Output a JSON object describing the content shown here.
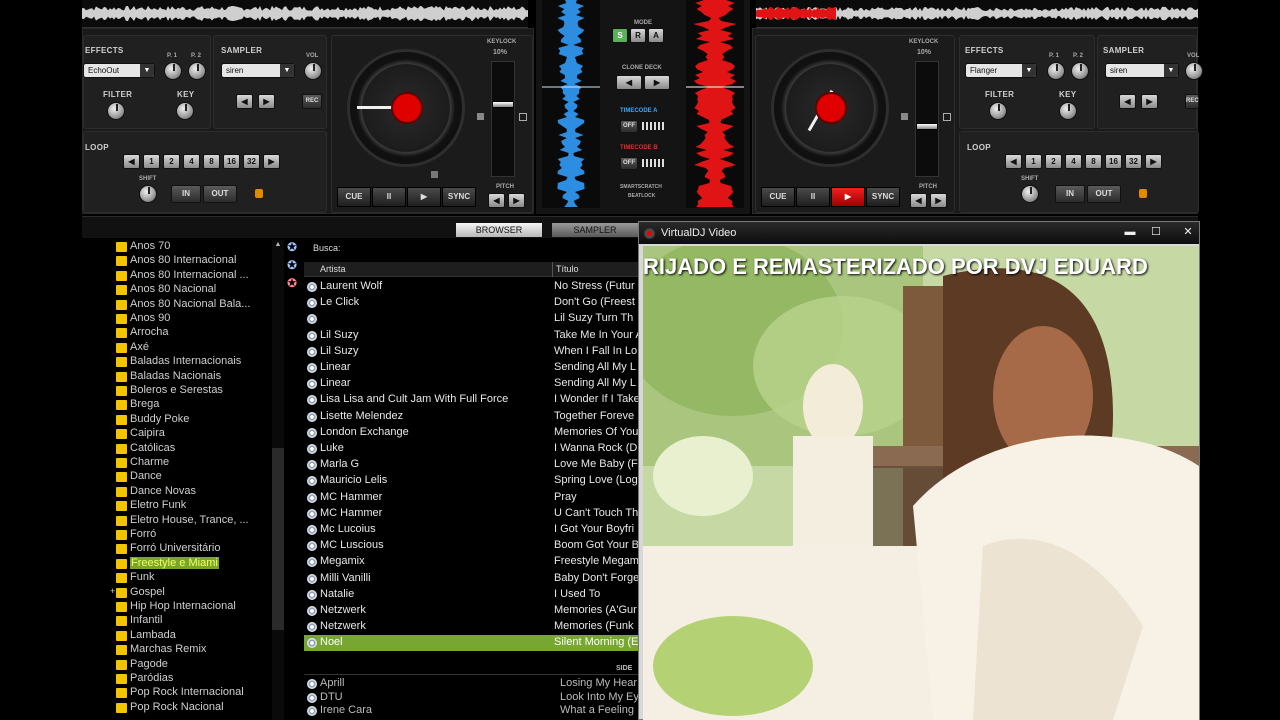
{
  "deck_left": {
    "effects": {
      "label": "EFFECTS",
      "value": "EchoOut",
      "p1": "P. 1",
      "p2": "P. 2"
    },
    "sampler": {
      "label": "SAMPLER",
      "value": "siren",
      "vol": "VOL",
      "rec": "REC"
    },
    "filter": "FILTER",
    "key": "KEY",
    "loop": {
      "label": "LOOP",
      "sizes": [
        "1",
        "2",
        "4",
        "8",
        "16",
        "32"
      ],
      "shift": "SHIFT",
      "in": "IN",
      "out": "OUT"
    },
    "keylock": "KEYLOCK",
    "pitch_pct": "10%",
    "pitch": "PITCH",
    "transport": {
      "cue": "CUE",
      "pause": "II",
      "play": "▶",
      "sync": "SYNC"
    }
  },
  "deck_right": {
    "effects": {
      "label": "EFFECTS",
      "value": "Flanger",
      "p1": "P. 1",
      "p2": "P. 2"
    },
    "sampler": {
      "label": "SAMPLER",
      "value": "siren",
      "vol": "VOL",
      "rec": "REC"
    },
    "filter": "FILTER",
    "key": "KEY",
    "loop": {
      "label": "LOOP",
      "sizes": [
        "1",
        "2",
        "4",
        "8",
        "16",
        "32"
      ],
      "shift": "SHIFT",
      "in": "IN",
      "out": "OUT"
    },
    "keylock": "KEYLOCK",
    "pitch_pct": "10%",
    "pitch": "PITCH",
    "transport": {
      "cue": "CUE",
      "pause": "II",
      "play": "▶",
      "sync": "SYNC"
    }
  },
  "mixer": {
    "mode": "MODE",
    "mode_buttons": [
      "S",
      "R",
      "A"
    ],
    "clone_deck": "CLONE DECK",
    "timecode_a": "TIMECODE A",
    "timecode_b": "TIMECODE B",
    "off": "OFF",
    "smartscratch": "SMARTSCRATCH",
    "beatlock": "BEATLOCK"
  },
  "tabs": {
    "browser": "BROWSER",
    "sampler": "SAMPLER"
  },
  "search_label": "Busca:",
  "columns": {
    "artist": "Artista",
    "title": "Título"
  },
  "folders": [
    "Anos 70",
    "Anos 80 Internacional",
    "Anos 80 Internacional ...",
    "Anos 80 Nacional",
    "Anos 80 Nacional Bala...",
    "Anos 90",
    "Arrocha",
    "Axé",
    "Baladas Internacionais",
    "Baladas Nacionais",
    "Boleros e Serestas",
    "Brega",
    "Buddy Poke",
    "Caipira",
    "Católicas",
    "Charme",
    "Dance",
    "Dance Novas",
    "Eletro Funk",
    "Eletro House, Trance, ...",
    "Forró",
    "Forró Universitário",
    "Freestyle e Miami",
    "Funk",
    "Gospel",
    "Hip Hop Internacional",
    "Infantil",
    "Lambada",
    "Marchas Remix",
    "Pagode",
    "Paródias",
    "Pop Rock Internacional",
    "Pop Rock Nacional"
  ],
  "selected_folder": "Freestyle e Miami",
  "tracks": [
    {
      "artist": "Laurent Wolf",
      "title": "No Stress (Futur"
    },
    {
      "artist": "Le Click",
      "title": "Don't Go (Freest"
    },
    {
      "artist": "",
      "title": "Lil Suzy   Turn Th"
    },
    {
      "artist": "Lil Suzy",
      "title": "Take Me In Your A"
    },
    {
      "artist": "Lil Suzy",
      "title": "When I Fall In Lo"
    },
    {
      "artist": "Linear",
      "title": "Sending All My L"
    },
    {
      "artist": "Linear",
      "title": "Sending All My L"
    },
    {
      "artist": "Lisa Lisa and Cult Jam With Full Force",
      "title": "I Wonder If I Take"
    },
    {
      "artist": "Lisette Melendez",
      "title": "Together Foreve"
    },
    {
      "artist": "London Exchange",
      "title": "Memories Of You"
    },
    {
      "artist": "Luke",
      "title": "I Wanna Rock (D"
    },
    {
      "artist": "Marla G",
      "title": "Love Me Baby (F"
    },
    {
      "artist": "Mauricio Lelis",
      "title": "Spring Love (Log"
    },
    {
      "artist": "MC Hammer",
      "title": "Pray"
    },
    {
      "artist": "MC Hammer",
      "title": "U Can't Touch Th"
    },
    {
      "artist": "Mc Lucoius",
      "title": "I Got Your Boyfri"
    },
    {
      "artist": "MC Luscious",
      "title": "Boom Got Your B"
    },
    {
      "artist": "Megamix",
      "title": "Freestyle Megam"
    },
    {
      "artist": "Milli Vanilli",
      "title": "Baby Don't Forge"
    },
    {
      "artist": "Natalie",
      "title": "I Used To"
    },
    {
      "artist": "Netzwerk",
      "title": "Memories (A'Gur"
    },
    {
      "artist": "Netzwerk",
      "title": "Memories (Funk"
    },
    {
      "artist": "Noel",
      "title": "Silent Morning (E"
    }
  ],
  "side_label": "SIDE",
  "side_tracks": [
    {
      "artist": "Aprill",
      "title": "Losing My Hear"
    },
    {
      "artist": "DTU",
      "title": "Look Into My Ey"
    },
    {
      "artist": "Irene Cara",
      "title": "What a Feeling"
    }
  ],
  "video_window": {
    "title": "VirtualDJ Video",
    "caption": "RIJADO E REMASTERIZADO POR DVJ EDUARD"
  },
  "colors": {
    "accent_green": "#77a731",
    "deck_red": "#e00000",
    "timecode_blue": "#3aa8ff"
  }
}
